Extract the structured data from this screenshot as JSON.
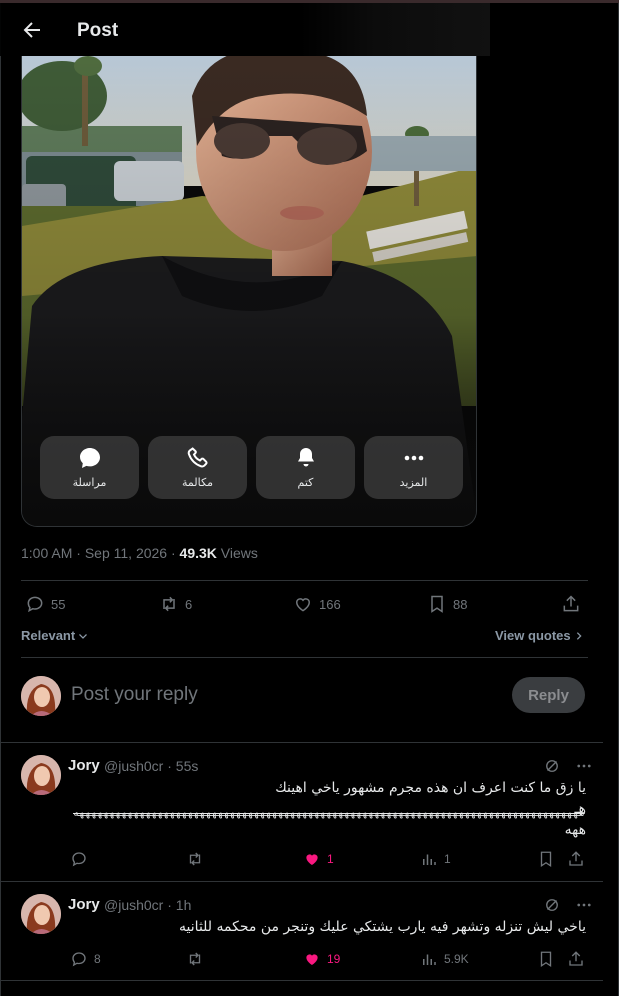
{
  "header": {
    "title": "Post"
  },
  "media_actions": [
    {
      "label": "مراسلة",
      "icon": "chat-bubble-icon"
    },
    {
      "label": "مكالمة",
      "icon": "phone-icon"
    },
    {
      "label": "كتم",
      "icon": "bell-icon"
    },
    {
      "label": "المزيد",
      "icon": "more-dots-icon"
    }
  ],
  "post_meta": {
    "time": "1:00 AM",
    "date": "Sep 11, 2026",
    "separator": "·",
    "views_count": "49.3K",
    "views_label": "Views"
  },
  "post_stats": {
    "replies": "55",
    "reposts": "6",
    "likes": "166",
    "bookmarks": "88"
  },
  "sort": {
    "label": "Relevant",
    "view_quotes": "View quotes"
  },
  "composer": {
    "placeholder": "Post your reply",
    "button": "Reply"
  },
  "replies": [
    {
      "name": "Jory",
      "handle": "@jush0cr · 55s",
      "text_line1": "يا زق ما كنت اعرف ان هذه مجرم مشهور ياخي اهينك",
      "text_line2": "هـ",
      "strike_text": "ههههههههههههههههههههههههههههههههههههههههههههههههههههههههههههههههههههههههههههههههههههه",
      "text_line3": "ههه",
      "stats": {
        "replies": "",
        "reposts": "",
        "likes": "1",
        "views": "1"
      }
    },
    {
      "name": "Jory",
      "handle": "@jush0cr · 1h",
      "text_line1": "ياخي ليش تنزله وتشهر فيه يارب يشتكي عليك وتنجر من محكمه للثانيه",
      "stats": {
        "replies": "8",
        "reposts": "",
        "likes": "19",
        "views": "5.9K"
      }
    }
  ],
  "colors": {
    "like_active": "#f91880",
    "muted": "#71767b",
    "text": "#e7e9ea",
    "border": "#2f3336"
  }
}
